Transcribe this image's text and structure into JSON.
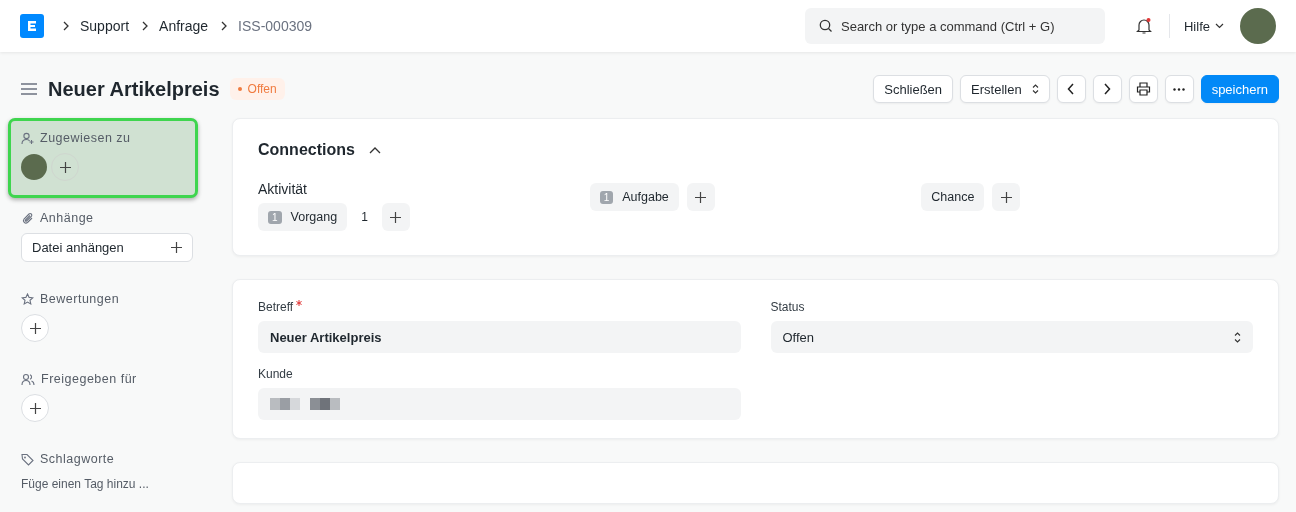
{
  "breadcrumbs": [
    {
      "label": "Support",
      "current": false
    },
    {
      "label": "Anfrage",
      "current": false
    },
    {
      "label": "ISS-000309",
      "current": true
    }
  ],
  "search": {
    "placeholder": "Search or type a command (Ctrl + G)"
  },
  "notifications": {
    "unread": true
  },
  "help_menu": {
    "label": "Hilfe"
  },
  "page": {
    "title": "Neuer Artikelpreis",
    "status": "Offen"
  },
  "actions": [
    {
      "kind": "button",
      "label": "Schließen"
    },
    {
      "kind": "dropdown",
      "label": "Erstellen"
    },
    {
      "kind": "prev"
    },
    {
      "kind": "next"
    },
    {
      "kind": "print"
    },
    {
      "kind": "more"
    },
    {
      "kind": "primary",
      "label": "speichern"
    }
  ],
  "sidebar": [
    {
      "kind": "assign",
      "label": "Zugewiesen zu",
      "highlighted": true
    },
    {
      "kind": "attach",
      "label": "Anhänge",
      "button": "Datei anhängen",
      "highlighted": false
    },
    {
      "kind": "rating",
      "label": "Bewertungen",
      "highlighted": false
    },
    {
      "kind": "share",
      "label": "Freigegeben für",
      "highlighted": false
    },
    {
      "kind": "tags",
      "label": "Schlagworte",
      "placeholder": "Füge einen Tag hinzu ...",
      "highlighted": false
    }
  ],
  "connections": {
    "title": "Connections",
    "expanded": true,
    "groups": [
      {
        "heading": "Aktivität",
        "items": [
          {
            "label": "Vorgang",
            "count": "1",
            "extra": "1"
          }
        ]
      },
      {
        "items": [
          {
            "label": "Aufgabe",
            "count": "1"
          }
        ]
      },
      {
        "items": [
          {
            "label": "Chance"
          }
        ]
      }
    ]
  },
  "form": {
    "fields": [
      {
        "kind": "text",
        "label": "Betreff",
        "required": true,
        "value": "Neuer Artikelpreis"
      },
      {
        "kind": "select",
        "label": "Status",
        "required": false,
        "value": "Offen"
      },
      {
        "kind": "redacted",
        "label": "Kunde",
        "required": false
      }
    ]
  }
}
